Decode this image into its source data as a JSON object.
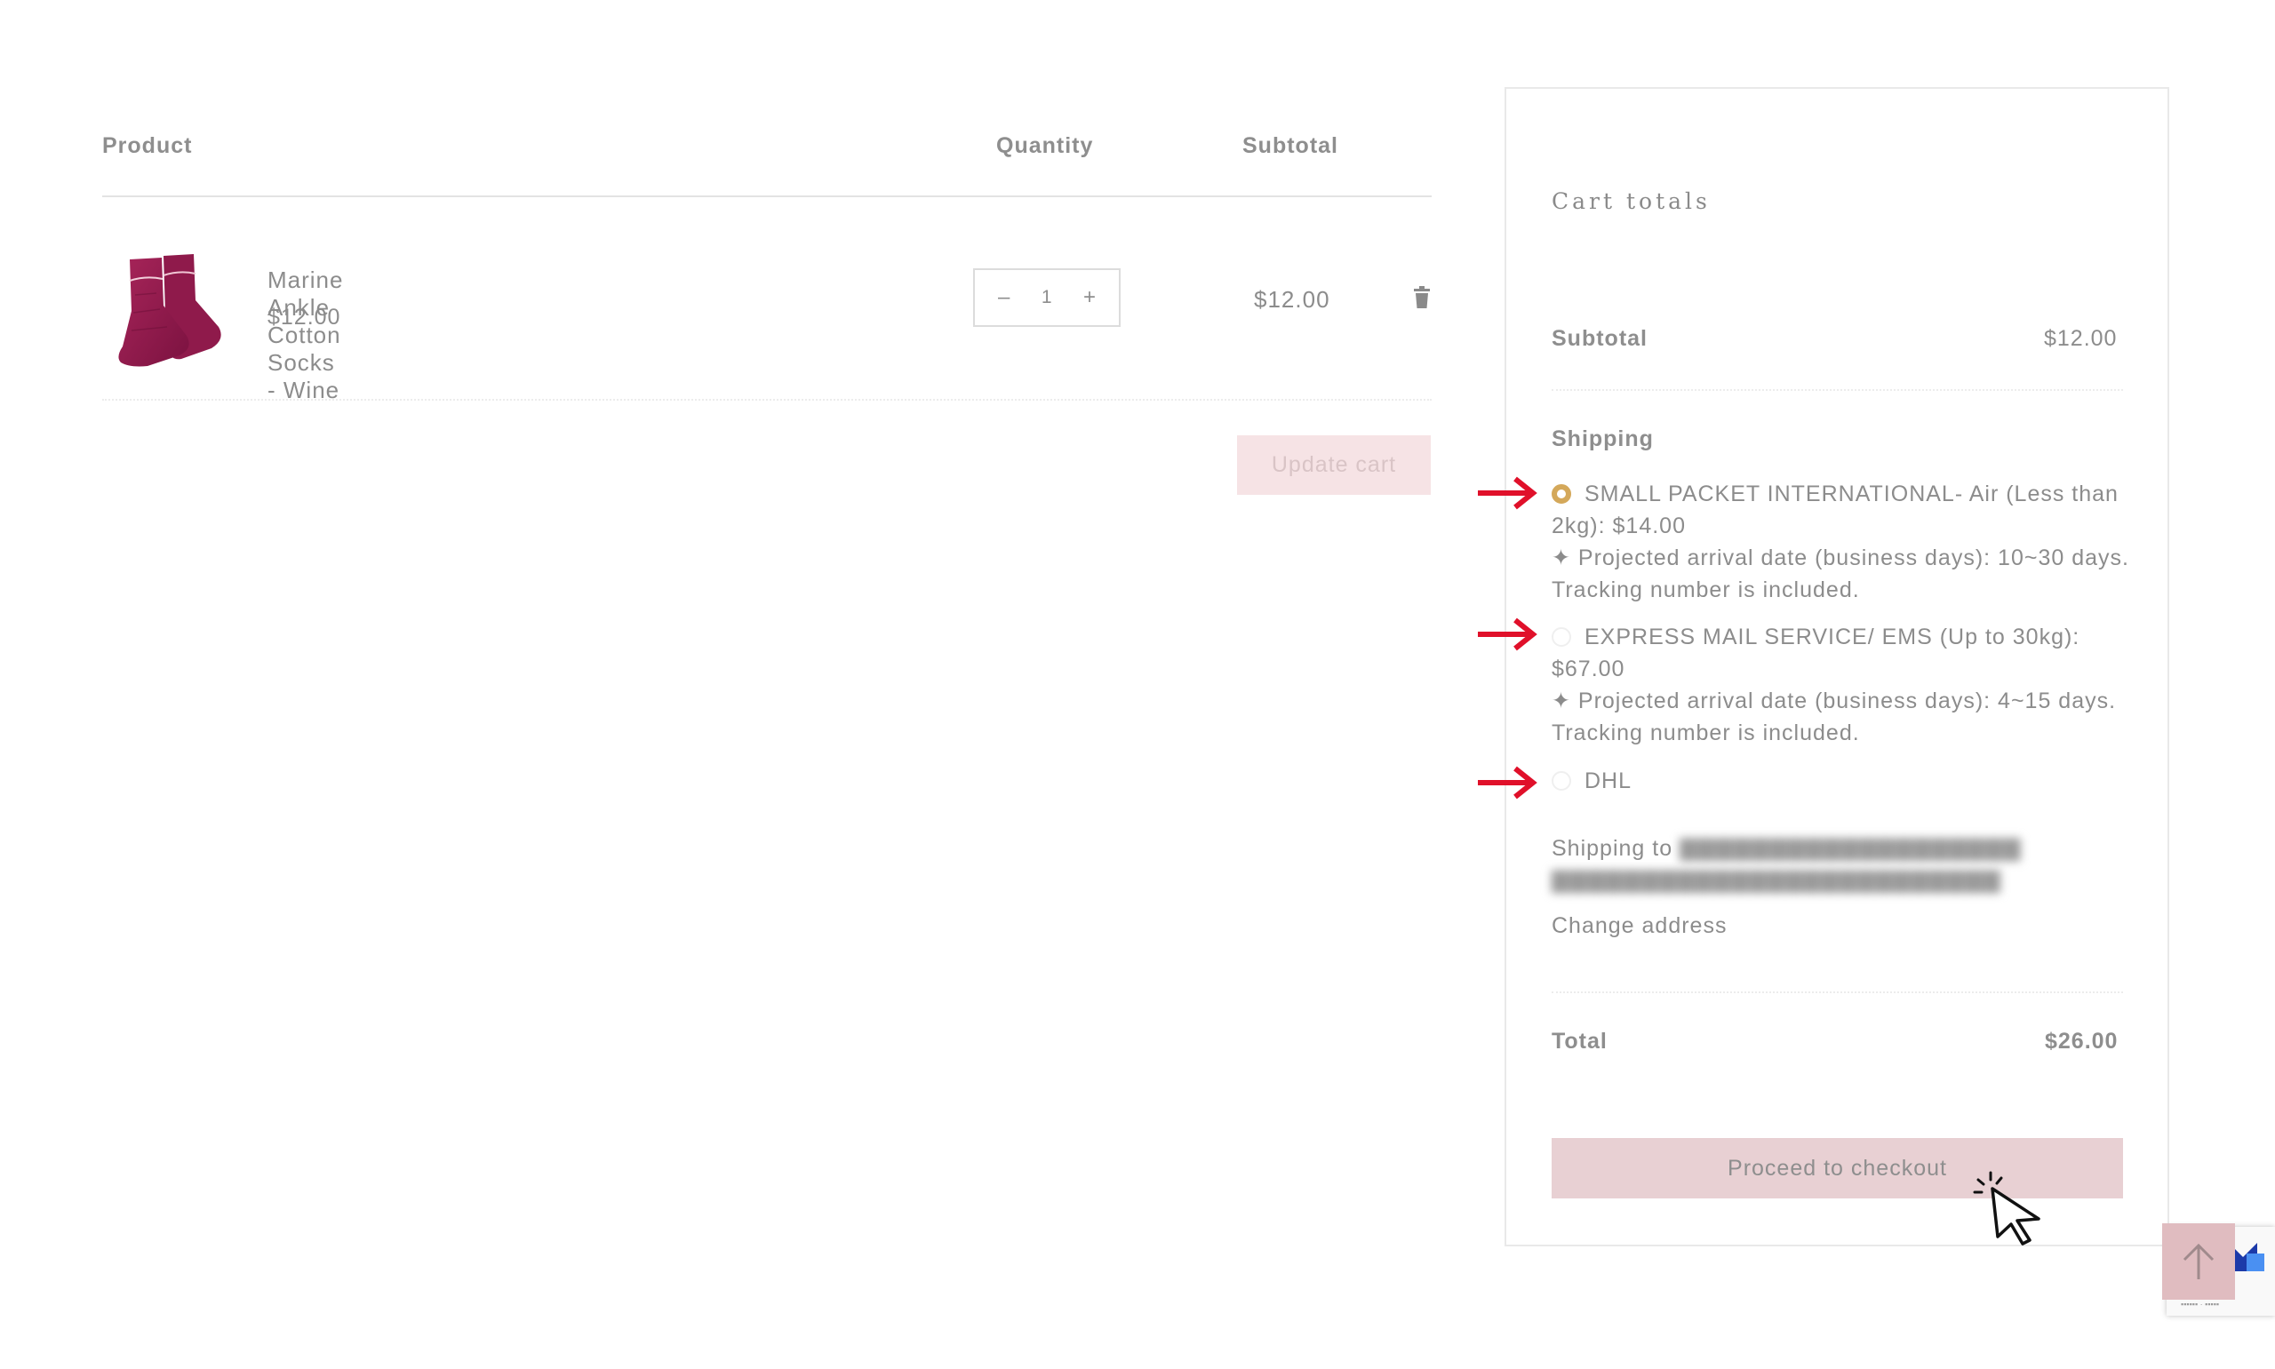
{
  "cart": {
    "headers": {
      "product": "Product",
      "quantity": "Quantity",
      "subtotal": "Subtotal"
    },
    "items": [
      {
        "name": "Marine Ankle Cotton Socks - Wine",
        "price": "$12.00",
        "quantity": "1",
        "subtotal": "$12.00",
        "image_icon": "wine-socks-image"
      }
    ],
    "qty_minus": "–",
    "qty_plus": "+",
    "update_button": "Update cart"
  },
  "totals": {
    "title": "Cart totals",
    "subtotal_label": "Subtotal",
    "subtotal_value": "$12.00",
    "shipping_label": "Shipping",
    "shipping_options": [
      {
        "label": "SMALL PACKET INTERNATIONAL- Air (Less than 2kg): $14.00",
        "detail": "✦ Projected arrival date (business days): 10~30 days. Tracking number is included.",
        "selected": true
      },
      {
        "label": "EXPRESS MAIL SERVICE/ EMS (Up to 30kg): $67.00",
        "detail": "✦ Projected arrival date (business days): 4~15 days. Tracking number is included.",
        "selected": false
      },
      {
        "label": "DHL",
        "detail": "",
        "selected": false
      }
    ],
    "shipping_to_label": "Shipping to",
    "change_address": "Change address",
    "total_label": "Total",
    "total_value": "$26.00",
    "checkout_button": "Proceed to checkout"
  },
  "colors": {
    "radio_selected": "#d4a85a",
    "annotation_arrow": "#e0102a",
    "checkout_bg": "#e8d0d3",
    "update_bg": "#f6e3e5",
    "scroll_top_bg": "#e0bcc0"
  },
  "icons": {
    "trash": "trash-icon",
    "arrow_annotation": "red-arrow-icon",
    "cursor": "mouse-pointer-icon",
    "scroll_top": "arrow-up-icon",
    "recaptcha": "recaptcha-logo-icon"
  }
}
